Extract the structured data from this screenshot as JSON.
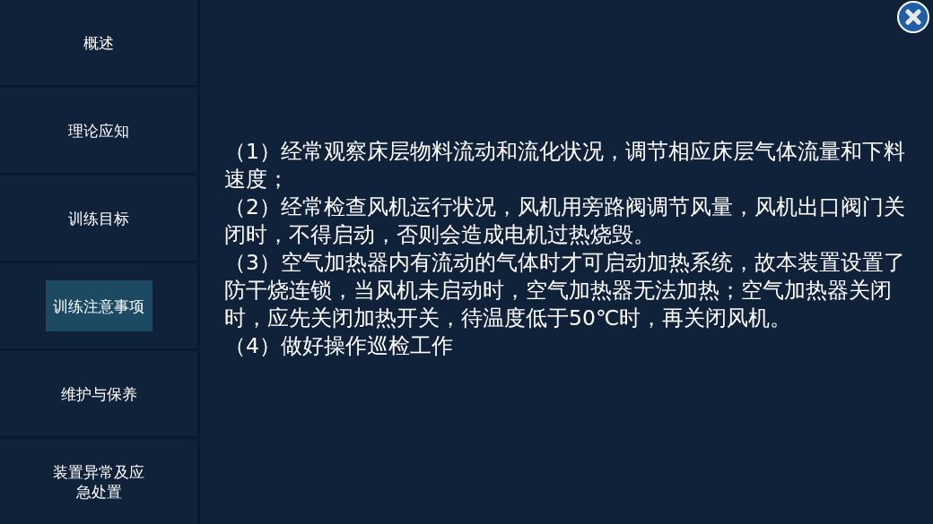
{
  "sidebar": {
    "items": [
      {
        "label": "概述",
        "selected": false
      },
      {
        "label": "理论应知",
        "selected": false
      },
      {
        "label": "训练目标",
        "selected": false
      },
      {
        "label": "训练注意事项",
        "selected": true
      },
      {
        "label": "维护与保养",
        "selected": false
      },
      {
        "label": "装置异常及应急处置",
        "selected": false
      }
    ]
  },
  "content": {
    "paragraphs": [
      "（1）经常观察床层物料流动和流化状况，调节相应床层气体流量和下料速度；",
      "（2）经常检查风机运行状况，风机用旁路阀调节风量，风机出口阀门关闭时，不得启动，否则会造成电机过热烧毁。",
      "（3）空气加热器内有流动的气体时才可启动加热系统，故本装置设置了防干烧连锁，当风机未启动时，空气加热器无法加热；空气加热器关闭时，应先关闭加热开关，待温度低于50℃时，再关闭风机。",
      "（4）做好操作巡检工作"
    ]
  }
}
